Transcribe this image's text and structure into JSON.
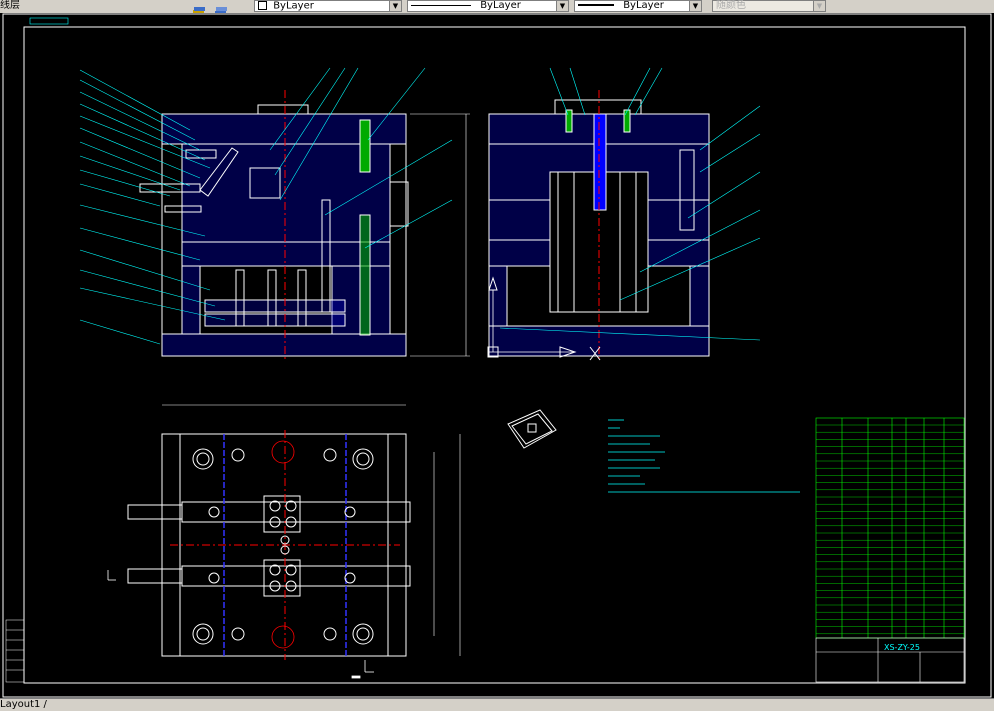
{
  "toolbar": {
    "layer_label": "线层",
    "color_combo": "ByLayer",
    "linetype_combo": "ByLayer",
    "lineweight_combo": "ByLayer",
    "plotstyle_combo": "随颜色"
  },
  "drawing": {
    "layout_tab_label": "Layout1",
    "title_block_text": "XS-ZY-25",
    "colors": {
      "background": "#000000",
      "outline": "#ffffff",
      "hatch": "#0000ff",
      "centerline": "#ff0000",
      "leader": "#00ffff",
      "table": "#00ff00",
      "accent_yellow": "#ffff00",
      "accent_magenta": "#ff00ff"
    }
  },
  "statusbar": {
    "tab_label": "Layout1 /"
  }
}
